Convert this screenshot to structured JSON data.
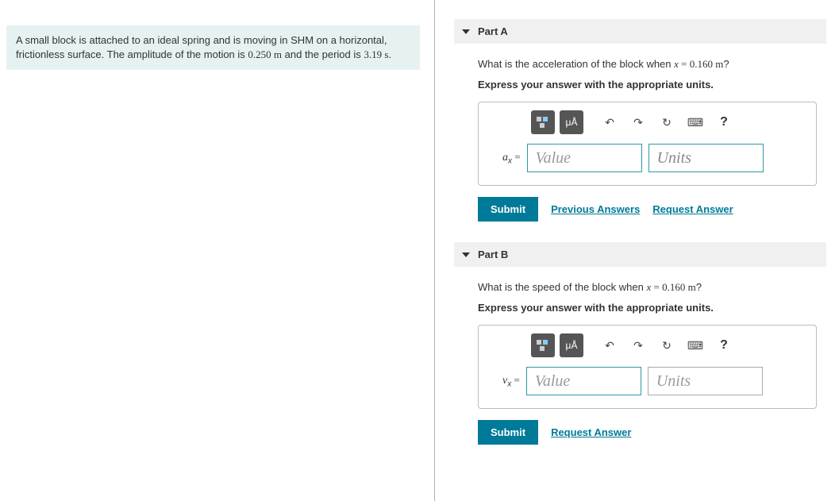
{
  "problem": {
    "text_pre": "A small block is attached to an ideal spring and is moving in SHM on a horizontal, frictionless surface. The amplitude of the motion is ",
    "amplitude": "0.250 m",
    "text_mid": " and the period is ",
    "period": "3.19 s",
    "text_end": "."
  },
  "partA": {
    "title": "Part A",
    "question_pre": "What is the acceleration of the block when ",
    "x_var": "x",
    "x_val": " = 0.160 m",
    "question_end": "?",
    "instruction": "Express your answer with the appropriate units.",
    "toolbar": {
      "templates": "",
      "special": "μÅ",
      "undo": "↶",
      "redo": "↷",
      "reset": "↻",
      "keyboard": "⌨",
      "help": "?"
    },
    "var_label": "a",
    "var_sub": "x",
    "eq": " = ",
    "value_placeholder": "Value",
    "units_placeholder": "Units",
    "submit": "Submit",
    "prev": "Previous Answers",
    "request": "Request Answer"
  },
  "partB": {
    "title": "Part B",
    "question_pre": "What is the speed of the block when ",
    "x_var": "x",
    "x_val": " = 0.160 m",
    "question_end": "?",
    "instruction": "Express your answer with the appropriate units.",
    "toolbar": {
      "templates": "",
      "special": "μÅ",
      "undo": "↶",
      "redo": "↷",
      "reset": "↻",
      "keyboard": "⌨",
      "help": "?"
    },
    "var_label": "v",
    "var_sub": "x",
    "eq": " = ",
    "value_placeholder": "Value",
    "units_placeholder": "Units",
    "submit": "Submit",
    "request": "Request Answer"
  }
}
